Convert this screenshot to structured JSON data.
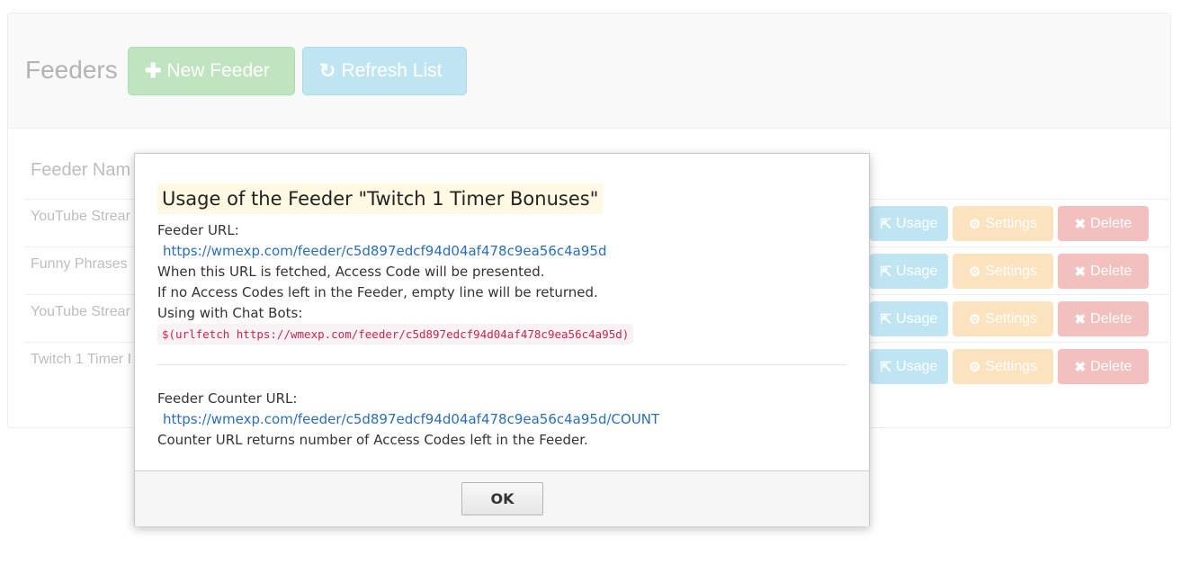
{
  "page": {
    "title": "Feeders",
    "new_button": "New Feeder",
    "refresh_button": "Refresh List",
    "column_header": "Feeder Nam",
    "rows": [
      {
        "name": "YouTube Strear",
        "usage": "Usage",
        "settings": "Settings",
        "delete": "Delete"
      },
      {
        "name": "Funny Phrases",
        "usage": "Usage",
        "settings": "Settings",
        "delete": "Delete"
      },
      {
        "name": "YouTube Strear",
        "usage": "Usage",
        "settings": "Settings",
        "delete": "Delete"
      },
      {
        "name": "Twitch 1 Timer I",
        "usage": "Usage",
        "settings": "Settings",
        "delete": "Delete"
      }
    ],
    "icons": {
      "new": "plus-icon",
      "refresh": "refresh-icon",
      "usage": "share-icon",
      "settings": "gear-icon",
      "delete": "close-icon"
    },
    "colors": {
      "success": "#bfe4bf",
      "info": "#c0e5f2",
      "warning": "#fbe3bf",
      "danger": "#f1c0bf"
    }
  },
  "modal": {
    "title": "Usage of the Feeder \"Twitch 1 Timer Bonuses\"",
    "feeder_url_label": "Feeder URL:",
    "feeder_url": "https://wmexp.com/feeder/c5d897edcf94d04af478c9ea56c4a95d",
    "desc_fetched": "When this URL is fetched, Access Code will be presented.",
    "desc_empty": "If no Access Codes left in the Feeder, empty line will be returned.",
    "chatbots_label": "Using with Chat Bots:",
    "chatbot_code": "$(urlfetch https://wmexp.com/feeder/c5d897edcf94d04af478c9ea56c4a95d)",
    "counter_label": "Feeder Counter URL:",
    "counter_url": "https://wmexp.com/feeder/c5d897edcf94d04af478c9ea56c4a95d/COUNT",
    "counter_desc": "Counter URL returns number of Access Codes left in the Feeder.",
    "ok_button": "OK"
  }
}
